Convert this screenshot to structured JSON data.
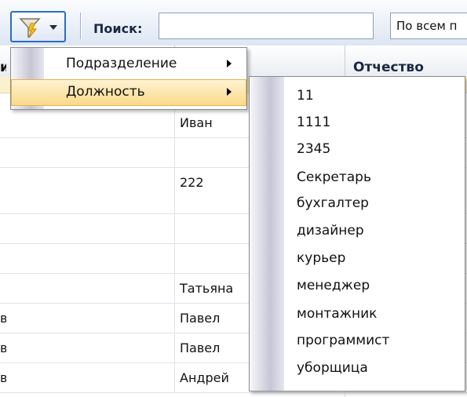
{
  "toolbar": {
    "search_label": "Поиск:",
    "search_value": "",
    "scope_value": "По всем п"
  },
  "grid": {
    "header": {
      "col1_stub": "и",
      "col3": "Отчество"
    },
    "rows": [
      {
        "stub": "",
        "name": "Иван"
      },
      {
        "stub": "",
        "name": ""
      },
      {
        "stub": "",
        "name": "222"
      },
      {
        "stub": "",
        "name": ""
      },
      {
        "stub": "",
        "name": ""
      },
      {
        "stub": "",
        "name": "Татьяна"
      },
      {
        "stub": "в",
        "name": "Павел"
      },
      {
        "stub": "в",
        "name": "Павел"
      },
      {
        "stub": "в",
        "name": "Андрей"
      }
    ]
  },
  "filter_menu": {
    "items": [
      {
        "label": "Подразделение"
      },
      {
        "label": "Должность"
      }
    ]
  },
  "position_submenu": {
    "items": [
      "11",
      "1111",
      "2345",
      "Секретарь",
      "бухгалтер",
      "дизайнер",
      "курьер",
      "менеджер",
      "монтажник",
      "программист",
      "уборщица"
    ]
  },
  "icons": {
    "filter": "filter-funnel-icon",
    "dropdown": "chevron-down-icon",
    "submenu_arrow": "chevron-right-icon"
  },
  "colors": {
    "accent_border": "#2c6cc4",
    "menu_highlight": "#fbd98a",
    "row_highlight": "#fbf1cf"
  }
}
